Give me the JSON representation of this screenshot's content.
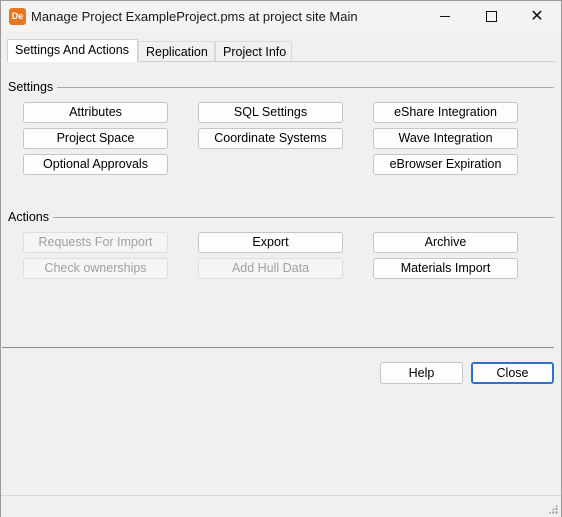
{
  "window": {
    "app_icon_text": "De",
    "title": "Manage Project ExampleProject.pms at project site Main",
    "minimize_glyph": "",
    "close_glyph": "✕"
  },
  "tabs": [
    {
      "label": "Settings And Actions",
      "active": true
    },
    {
      "label": "Replication",
      "active": false
    },
    {
      "label": "Project Info",
      "active": false
    }
  ],
  "settings": {
    "label": "Settings",
    "buttons": {
      "attributes": "Attributes",
      "sql_settings": "SQL Settings",
      "eshare_integration": "eShare Integration",
      "project_space": "Project Space",
      "coordinate_systems": "Coordinate Systems",
      "wave_integration": "Wave Integration",
      "optional_approvals": "Optional Approvals",
      "ebrowser_expiration": "eBrowser Expiration"
    }
  },
  "actions": {
    "label": "Actions",
    "buttons": {
      "requests_for_import": "Requests For Import",
      "export": "Export",
      "archive": "Archive",
      "check_ownerships": "Check ownerships",
      "add_hull_data": "Add Hull Data",
      "materials_import": "Materials Import"
    }
  },
  "dialog": {
    "help": "Help",
    "close": "Close"
  },
  "colors": {
    "app_icon": "#e8751f",
    "default_button_border": "#2e6fd0",
    "disabled_text": "#a0a0a0"
  },
  "icons": [
    "app-icon",
    "minimize-icon",
    "maximize-icon",
    "close-icon",
    "resize-grip-icon"
  ]
}
